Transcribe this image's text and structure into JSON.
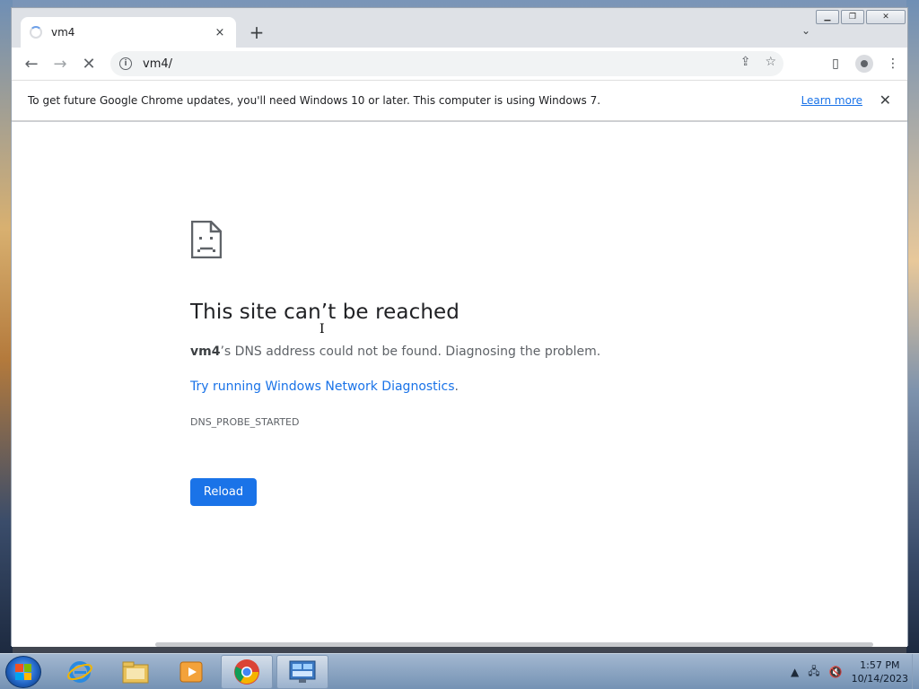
{
  "browser": {
    "tab_title": "vm4",
    "url": "vm4/",
    "new_tab_symbol": "+",
    "tab_close_symbol": "×"
  },
  "infobar": {
    "message": "To get future Google Chrome updates, you'll need Windows 10 or later. This computer is using Windows 7.",
    "link": "Learn more",
    "close_symbol": "✕"
  },
  "error_page": {
    "title": "This site can’t be reached",
    "host": "vm4",
    "description_rest": "’s DNS address could not be found. Diagnosing the problem.",
    "diagnostics_link": "Try running Windows Network Diagnostics",
    "diagnostics_dot": ".",
    "error_code": "DNS_PROBE_STARTED",
    "reload_label": "Reload"
  },
  "taskbar": {
    "apps": [
      "internet-explorer",
      "windows-explorer",
      "media-player",
      "chrome",
      "control-panel"
    ],
    "clock_time": "1:57 PM",
    "clock_date": "10/14/2023"
  },
  "colors": {
    "accent": "#1a73e8",
    "text_primary": "#202124",
    "text_secondary": "#5f6368"
  }
}
